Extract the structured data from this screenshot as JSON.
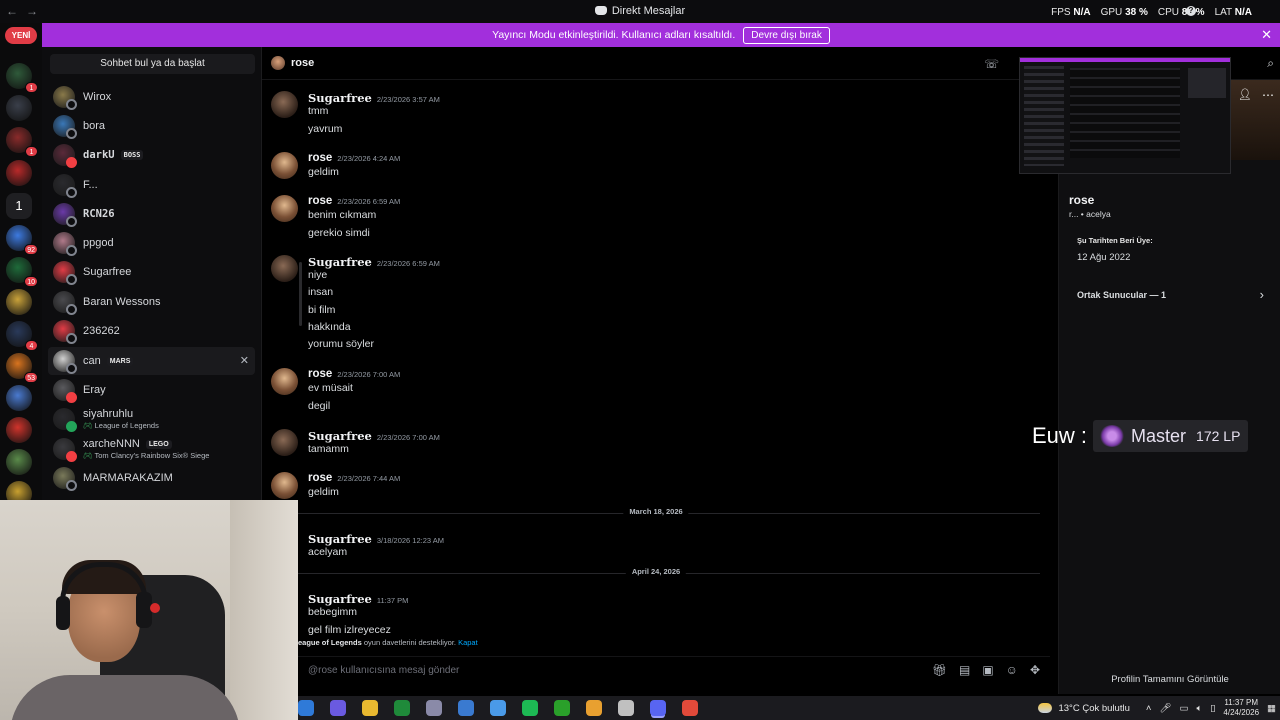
{
  "titlebar": {
    "title": "Direkt Mesajlar"
  },
  "stats": [
    {
      "label": "FPS",
      "value": "N/A"
    },
    {
      "label": "GPU",
      "value": "38 %"
    },
    {
      "label": "CPU",
      "value": "80 %"
    },
    {
      "label": "LAT",
      "value": "N/A"
    }
  ],
  "banner": {
    "text": "Yayıncı Modu etkinleştirildi. Kullanıcı adları kısaltıldı.",
    "button": "Devre dışı bırak"
  },
  "rail": {
    "new_label": "YENİ",
    "servers": [
      {
        "color": "#2f5a3a",
        "badge": "1"
      },
      {
        "color": "#3a3f4a",
        "badge": ""
      },
      {
        "color": "#8a2b2b",
        "badge": "1"
      },
      {
        "color": "#b82a2a",
        "badge": ""
      },
      {
        "text": "1",
        "badge": "1"
      },
      {
        "color": "#3d7ae0",
        "badge": "92"
      },
      {
        "color": "#1f6b3a",
        "badge": "10"
      },
      {
        "color": "#c9a23a",
        "badge": ""
      },
      {
        "color": "#2a3a5a",
        "badge": "4"
      },
      {
        "color": "#d8741f",
        "badge": "53"
      },
      {
        "color": "#4a7ad0",
        "badge": ""
      },
      {
        "color": "#d0342c",
        "badge": ""
      },
      {
        "color": "#5a8a4a",
        "badge": ""
      },
      {
        "color": "#c8a030",
        "badge": ""
      }
    ]
  },
  "dmlist": {
    "search_label": "Sohbet bul ya da başlat",
    "items": [
      {
        "name": "Wirox",
        "status": "off",
        "color": "#8a7a4a"
      },
      {
        "name": "bora",
        "status": "off",
        "color": "#3a78b8"
      },
      {
        "name": "darkU",
        "tag": "BOSS",
        "status": "dnd",
        "color": "#5a2a3a",
        "mono": true
      },
      {
        "name": "F...",
        "status": "off",
        "color": "#2a2a2e"
      },
      {
        "name": "RCN26",
        "status": "off",
        "color": "#6a3aa8",
        "mono": true
      },
      {
        "name": "ppgod",
        "status": "off",
        "color": "#b07a8a"
      },
      {
        "name": "Sugarfree",
        "status": "off",
        "color": "#e13c46"
      },
      {
        "name": "Baran Wessons",
        "status": "off",
        "color": "#4a4a4e"
      },
      {
        "name": "236262",
        "status": "off",
        "color": "#e13c46"
      },
      {
        "name": "can",
        "tag": "MARS",
        "status": "off",
        "color": "#d0d0d0",
        "selected": true
      },
      {
        "name": "Eray",
        "status": "dnd",
        "color": "#5a5a5e"
      },
      {
        "name": "siyahruhlu",
        "sub": "League of Legends",
        "status": "on",
        "color": "#2a2a2e"
      },
      {
        "name": "xarcheNNN",
        "tag": "LEGO",
        "sub": "Tom Clancy's Rainbow Six® Siege",
        "status": "dnd",
        "color": "#3a3a3e"
      },
      {
        "name": "MARMARAKAZIM",
        "status": "off",
        "color": "#7a7a5a"
      }
    ]
  },
  "chat": {
    "recipient": "rose",
    "messages": [
      {
        "author": "Sugarfree",
        "who": "sugar",
        "time": "2/23/2026 3:57 AM",
        "lines": [
          "tmm",
          "yavrum"
        ]
      },
      {
        "author": "rose",
        "who": "rose",
        "time": "2/23/2026 4:24 AM",
        "lines": [
          "geldim"
        ]
      },
      {
        "author": "rose",
        "who": "rose",
        "time": "2/23/2026 6:59 AM",
        "lines": [
          "benim cıkmam",
          "gerekio simdi"
        ]
      },
      {
        "author": "Sugarfree",
        "who": "sugar",
        "time": "2/23/2026 6:59 AM",
        "lines": [
          "niye",
          "insan",
          "bi film",
          "hakkında",
          "yorumu söyler"
        ]
      },
      {
        "author": "rose",
        "who": "rose",
        "time": "2/23/2026 7:00 AM",
        "lines": [
          "ev müsait",
          "degil"
        ]
      },
      {
        "author": "Sugarfree",
        "who": "sugar",
        "time": "2/23/2026 7:00 AM",
        "lines": [
          "tamamm"
        ]
      },
      {
        "author": "rose",
        "who": "rose",
        "time": "2/23/2026 7:44 AM",
        "lines": [
          "geldim"
        ]
      },
      {
        "author": "Sugarfree",
        "who": "sugar",
        "time": "3/18/2026 12:23 AM",
        "lines": [
          "acelyam"
        ]
      },
      {
        "author": "Sugarfree",
        "who": "sugar",
        "time": "11:37 PM",
        "lines": [
          "bebegimm",
          "gel film izlreyecez"
        ]
      }
    ],
    "dividers": [
      "March 18, 2026",
      "April 24, 2026"
    ],
    "invite_game": "eague of Legends",
    "invite_text": " oyun davetlerini destekliyor. ",
    "invite_close": "Kapat",
    "placeholder": "@rose kullanıcısına mesaj gönder"
  },
  "profile": {
    "name": "rose",
    "sub": "r... • acelya",
    "since_label": "Şu Tarihten Beri Üye:",
    "since_value": "12 Ağu 2022",
    "mutual": "Ortak Sunucular — 1",
    "full_profile": "Profilin Tamamını Görüntüle"
  },
  "rank": {
    "region": "Euw :",
    "tier": "Master",
    "lp": "172 LP"
  },
  "taskbar": {
    "weather": "13°C  Çok bulutlu",
    "time": "11:37 PM",
    "date": "4/24/2026",
    "apps": [
      "#2f7ad8",
      "#6a5ae0",
      "#e8b830",
      "#1f8a3a",
      "#8a8aa8",
      "#3a7ad0",
      "#4a9ae8",
      "#1db954",
      "#2aa02a",
      "#e8a030",
      "#c0c0c0",
      "#5865f2",
      "#e24a3a"
    ]
  }
}
